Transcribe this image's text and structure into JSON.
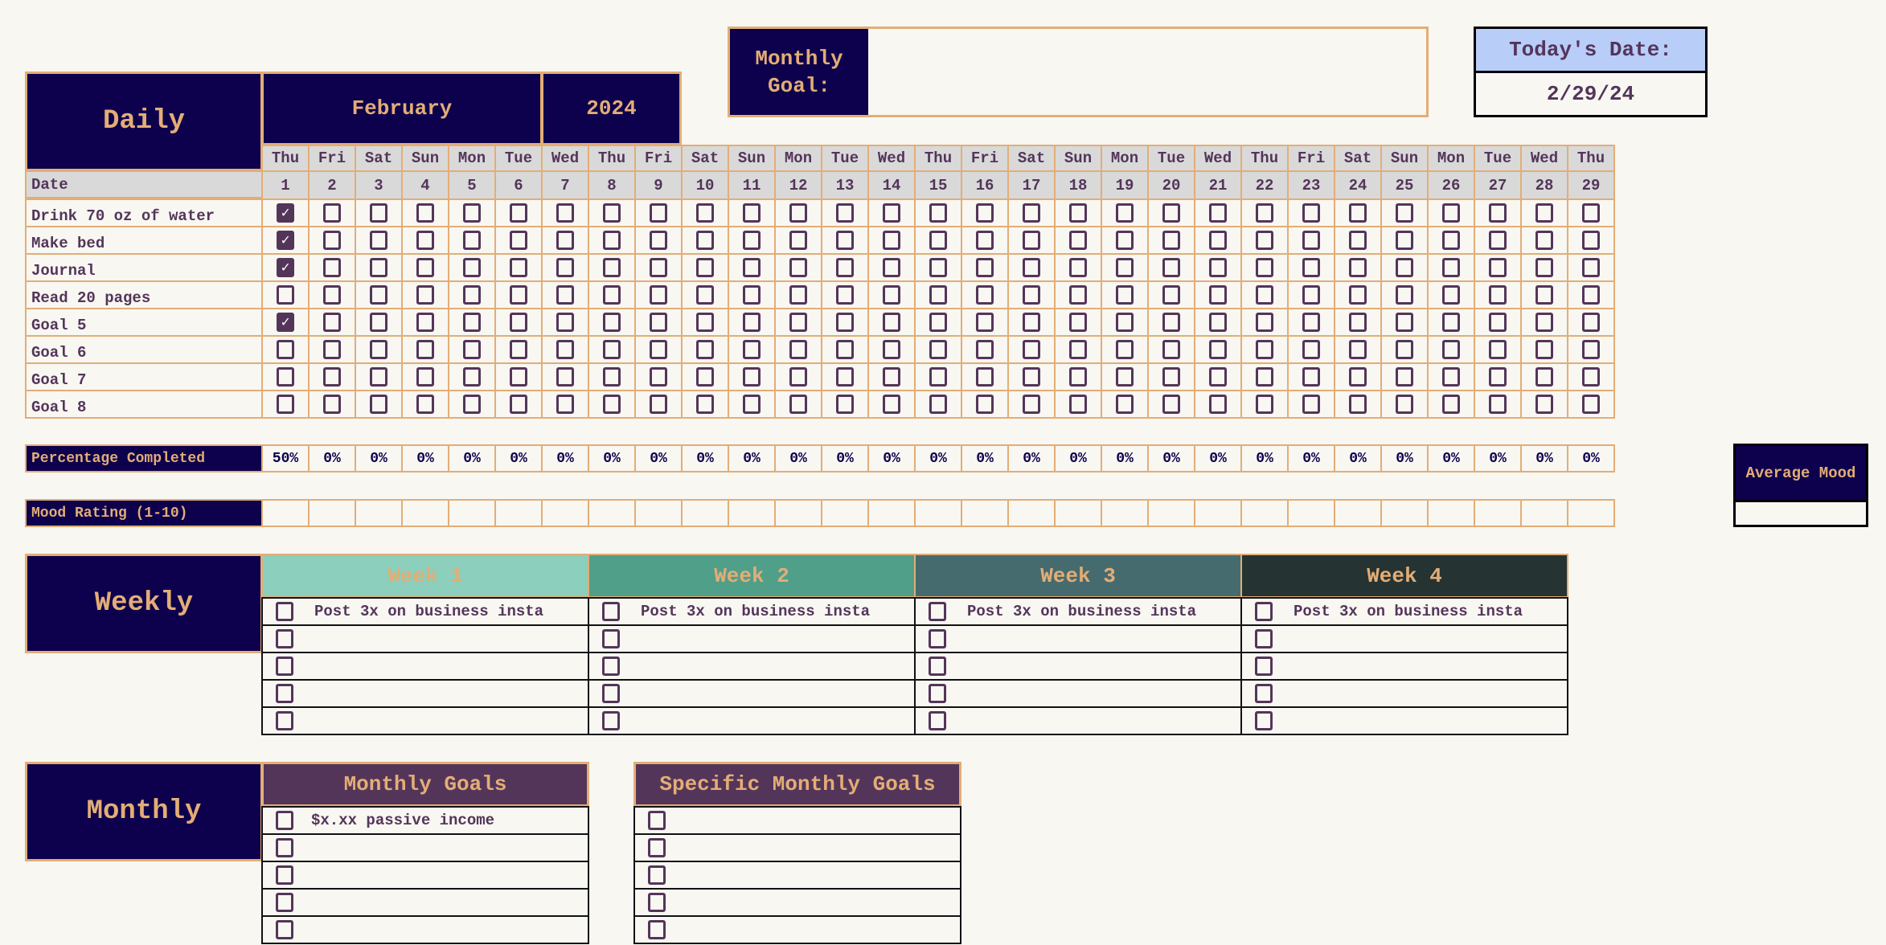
{
  "header": {
    "daily_title": "Daily",
    "month": "February",
    "year": "2024",
    "monthly_goal_label": "Monthly Goal:",
    "monthly_goal_value": "",
    "todays_date_label": "Today's Date:",
    "todays_date_value": "2/29/24"
  },
  "daily": {
    "date_label": "Date",
    "weekdays": [
      "Thu",
      "Fri",
      "Sat",
      "Sun",
      "Mon",
      "Tue",
      "Wed",
      "Thu",
      "Fri",
      "Sat",
      "Sun",
      "Mon",
      "Tue",
      "Wed",
      "Thu",
      "Fri",
      "Sat",
      "Sun",
      "Mon",
      "Tue",
      "Wed",
      "Thu",
      "Fri",
      "Sat",
      "Sun",
      "Mon",
      "Tue",
      "Wed",
      "Thu"
    ],
    "dates": [
      "1",
      "2",
      "3",
      "4",
      "5",
      "6",
      "7",
      "8",
      "9",
      "10",
      "11",
      "12",
      "13",
      "14",
      "15",
      "16",
      "17",
      "18",
      "19",
      "20",
      "21",
      "22",
      "23",
      "24",
      "25",
      "26",
      "27",
      "28",
      "29"
    ],
    "goals": [
      {
        "label": "Drink 70 oz of water",
        "checked_days": [
          1
        ]
      },
      {
        "label": "Make bed",
        "checked_days": [
          1
        ]
      },
      {
        "label": "Journal",
        "checked_days": [
          1
        ]
      },
      {
        "label": "Read 20 pages",
        "checked_days": []
      },
      {
        "label": "Goal 5",
        "checked_days": [
          1
        ]
      },
      {
        "label": "Goal 6",
        "checked_days": []
      },
      {
        "label": "Goal 7",
        "checked_days": []
      },
      {
        "label": "Goal 8",
        "checked_days": []
      }
    ],
    "percentage_label": "Percentage Completed",
    "percentages": [
      "50%",
      "0%",
      "0%",
      "0%",
      "0%",
      "0%",
      "0%",
      "0%",
      "0%",
      "0%",
      "0%",
      "0%",
      "0%",
      "0%",
      "0%",
      "0%",
      "0%",
      "0%",
      "0%",
      "0%",
      "0%",
      "0%",
      "0%",
      "0%",
      "0%",
      "0%",
      "0%",
      "0%",
      "0%"
    ],
    "mood_label": "Mood Rating (1-10)",
    "average_mood_label": "Average Mood",
    "average_mood_value": ""
  },
  "weekly": {
    "title": "Weekly",
    "weeks": [
      {
        "label": "Week 1",
        "color": "#8bcfbc",
        "items": [
          "Post 3x on business insta",
          "",
          "",
          "",
          ""
        ]
      },
      {
        "label": "Week 2",
        "color": "#509f89",
        "items": [
          "Post 3x on business insta",
          "",
          "",
          "",
          ""
        ]
      },
      {
        "label": "Week 3",
        "color": "#466b6f",
        "items": [
          "Post 3x on business insta",
          "",
          "",
          "",
          ""
        ]
      },
      {
        "label": "Week 4",
        "color": "#253333",
        "items": [
          "Post 3x on business insta",
          "",
          "",
          "",
          ""
        ]
      }
    ]
  },
  "monthly": {
    "title": "Monthly",
    "lists": [
      {
        "label": "Monthly Goals",
        "items": [
          "$x.xx passive income",
          "",
          "",
          "",
          ""
        ]
      },
      {
        "label": "Specific Monthly Goals",
        "items": [
          "",
          "",
          "",
          "",
          ""
        ]
      }
    ]
  },
  "colors": {
    "navy": "#0d004c",
    "gold": "#e3ad76",
    "plum": "#54355a",
    "gray": "#d9d9d9",
    "date_blue": "#b8cdf8"
  }
}
